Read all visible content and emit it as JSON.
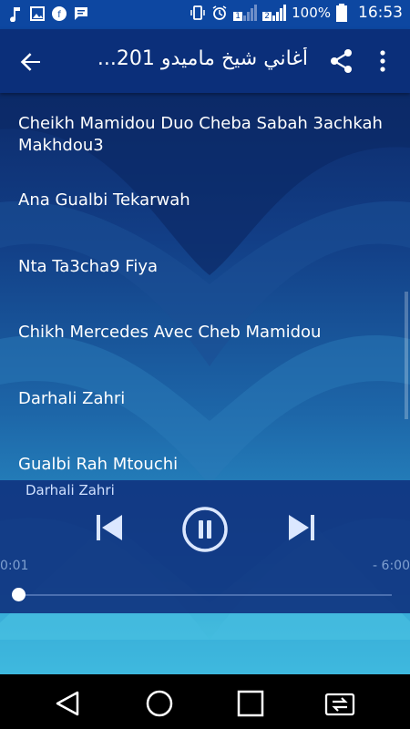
{
  "status": {
    "battery_percent": "100%",
    "time": "16:53",
    "sim1": "1",
    "sim2": "2"
  },
  "appbar": {
    "title": "أغاني شيخ ماميدو 201...",
    "back_icon": "arrow-back-icon",
    "share_icon": "share-icon",
    "more_icon": "more-vertical-icon"
  },
  "songs": [
    "Cheikh Mamidou Duo Cheba Sabah 3achkah Makhdou3",
    "Ana Gualbi Tekarwah",
    "Nta Ta3cha9 Fiya",
    "Chikh Mercedes Avec Cheb Mamidou",
    "Darhali Zahri",
    "Gualbi Rah Mtouchi"
  ],
  "player": {
    "now_playing": "Darhali Zahri",
    "elapsed": "0:01",
    "remaining": "- 6:00",
    "progress": 0.003
  }
}
